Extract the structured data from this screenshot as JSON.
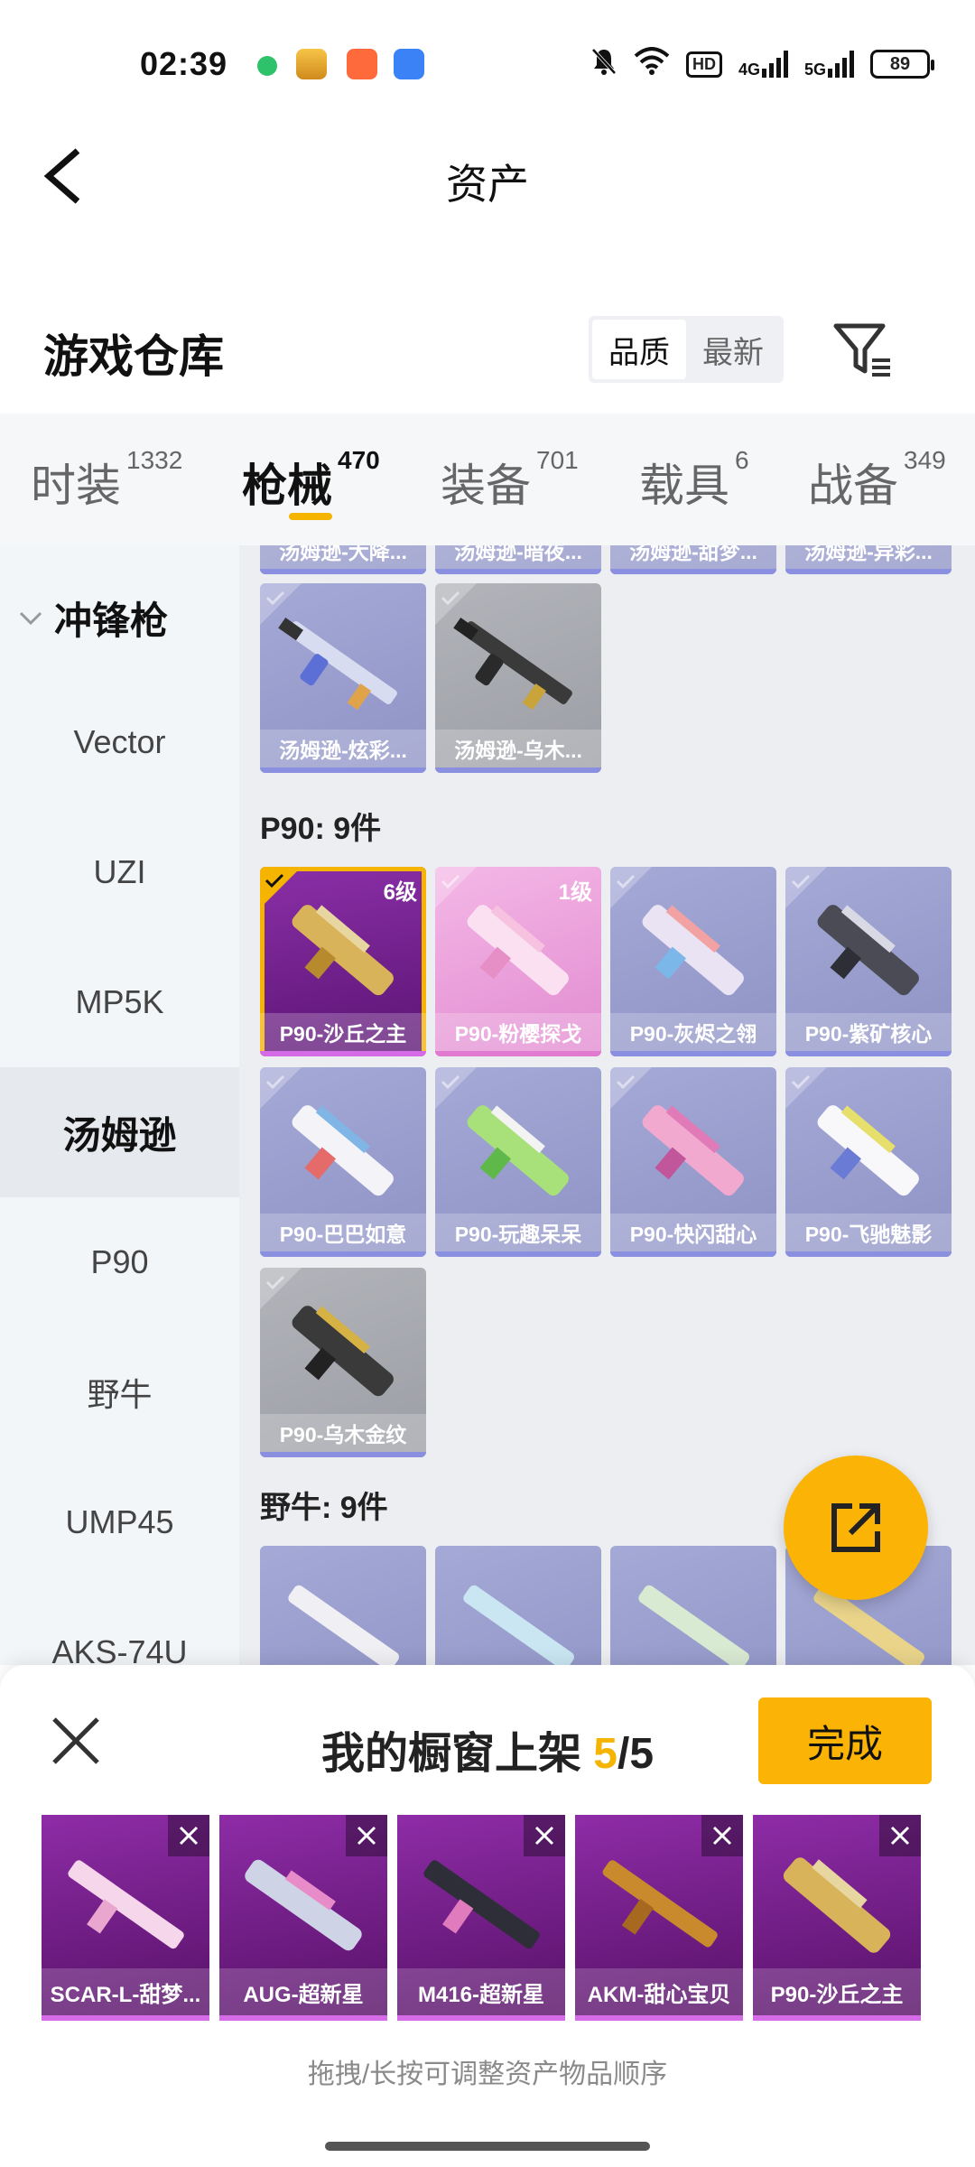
{
  "status_bar": {
    "time": "02:39",
    "battery": "89",
    "hd_label": "HD",
    "net1": "4G",
    "net2": "5G"
  },
  "header": {
    "title": "资产"
  },
  "warehouse": {
    "title": "游戏仓库",
    "sort_options": [
      "品质",
      "最新"
    ],
    "sort_active": "品质"
  },
  "tabs": [
    {
      "label": "时装",
      "count": "1332"
    },
    {
      "label": "枪械",
      "count": "470"
    },
    {
      "label": "装备",
      "count": "701"
    },
    {
      "label": "载具",
      "count": "6"
    },
    {
      "label": "战备",
      "count": "349"
    }
  ],
  "sidebar": {
    "category": "冲锋枪",
    "items": [
      "Vector",
      "UZI",
      "MP5K",
      "汤姆逊",
      "P90",
      "野牛",
      "UMP45",
      "AKS-74U"
    ],
    "active": "汤姆逊"
  },
  "content": {
    "top_partial_names": [
      "汤姆逊-大降...",
      "汤姆逊-暗夜...",
      "汤姆逊-甜梦...",
      "汤姆逊-异彩..."
    ],
    "thompson_items": [
      "汤姆逊-炫彩...",
      "汤姆逊-乌木..."
    ],
    "p90_section": "P90: 9件",
    "p90_items": [
      {
        "name": "P90-沙丘之主",
        "level": "6级"
      },
      {
        "name": "P90-粉樱探戈",
        "level": "1级"
      },
      {
        "name": "P90-灰烬之翎",
        "level": ""
      },
      {
        "name": "P90-紫矿核心",
        "level": ""
      },
      {
        "name": "P90-巴巴如意",
        "level": ""
      },
      {
        "name": "P90-玩趣呆呆",
        "level": ""
      },
      {
        "name": "P90-快闪甜心",
        "level": ""
      },
      {
        "name": "P90-飞驰魅影",
        "level": ""
      },
      {
        "name": "P90-乌木金纹",
        "level": ""
      }
    ],
    "bison_section": "野牛: 9件"
  },
  "showcase": {
    "title_prefix": "我的橱窗上架 ",
    "count": "5",
    "total": "/5",
    "done_label": "完成",
    "items": [
      "SCAR-L-甜梦...",
      "AUG-超新星",
      "M416-超新星",
      "AKM-甜心宝贝",
      "P90-沙丘之主"
    ],
    "hint": "拖拽/长按可调整资产物品顺序"
  },
  "colors": {
    "accent": "#f5b400",
    "legendary": "#5a1472",
    "epic_pink": "#e18ad0",
    "rare_blue": "#8f93c5"
  }
}
